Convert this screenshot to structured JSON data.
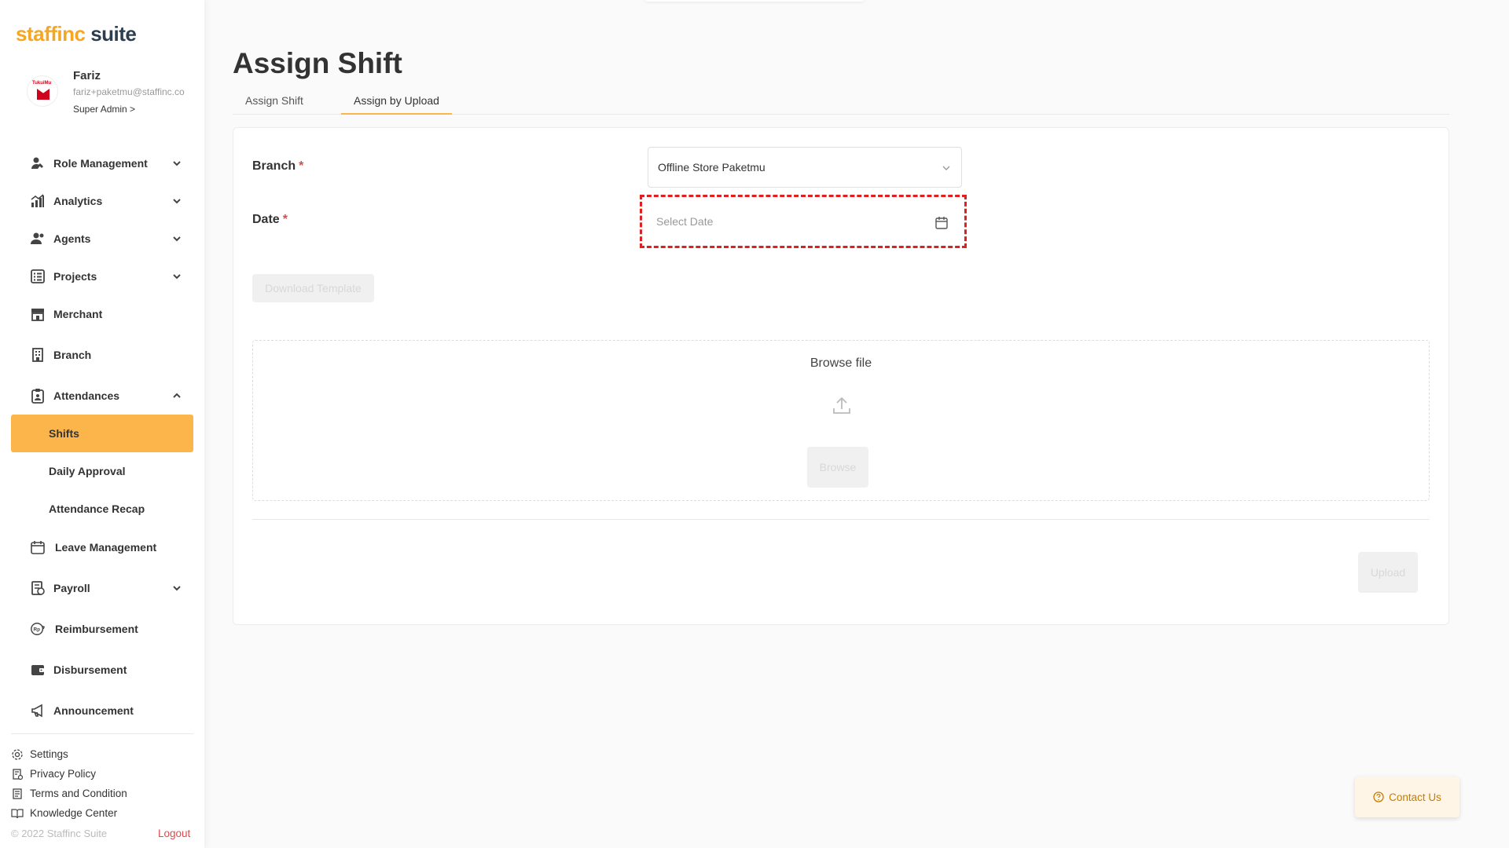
{
  "brand": {
    "name_part1": "staffinc",
    "name_part2": " suite",
    "accent": "#fbb54a"
  },
  "profile": {
    "name": "Fariz",
    "email": "fariz+paketmu@staffinc.co",
    "role": "Super Admin >",
    "avatar_text": "TukuiMu"
  },
  "sidebar": {
    "items": [
      {
        "label": "Role Management",
        "icon": "role-icon",
        "expandable": true
      },
      {
        "label": "Analytics",
        "icon": "analytics-icon",
        "expandable": true
      },
      {
        "label": "Agents",
        "icon": "agents-icon",
        "expandable": true
      },
      {
        "label": "Projects",
        "icon": "projects-icon",
        "expandable": true
      },
      {
        "label": "Merchant",
        "icon": "merchant-icon",
        "expandable": false
      },
      {
        "label": "Branch",
        "icon": "branch-icon",
        "expandable": false
      },
      {
        "label": "Attendances",
        "icon": "attendances-icon",
        "expandable": true,
        "expanded": true,
        "children": [
          {
            "label": "Shifts",
            "active": true
          },
          {
            "label": "Daily Approval"
          },
          {
            "label": "Attendance Recap"
          }
        ]
      },
      {
        "label": "Leave Management",
        "icon": "calendar-icon",
        "expandable": false
      },
      {
        "label": "Payroll",
        "icon": "payroll-icon",
        "expandable": true
      },
      {
        "label": "Reimbursement",
        "icon": "reimbursement-icon",
        "expandable": false
      },
      {
        "label": "Disbursement",
        "icon": "wallet-icon",
        "expandable": false
      },
      {
        "label": "Announcement",
        "icon": "megaphone-icon",
        "expandable": false
      }
    ],
    "footer": [
      {
        "label": "Settings",
        "icon": "gear-icon"
      },
      {
        "label": "Privacy Policy",
        "icon": "privacy-icon"
      },
      {
        "label": "Terms and Condition",
        "icon": "document-icon"
      },
      {
        "label": "Knowledge Center",
        "icon": "book-icon"
      }
    ],
    "copyright": "© 2022 Staffinc Suite",
    "logout": "Logout"
  },
  "page": {
    "title": "Assign Shift",
    "tabs": [
      {
        "label": "Assign Shift",
        "active": false
      },
      {
        "label": "Assign by Upload",
        "active": true
      }
    ]
  },
  "form": {
    "branch_label": "Branch",
    "branch_value": "Offline Store Paketmu",
    "date_label": "Date",
    "date_placeholder": "Select Date",
    "required_mark": "*",
    "download_template": "Download Template",
    "browse_title": "Browse file",
    "browse_button": "Browse",
    "upload_button": "Upload"
  },
  "contact": {
    "label": "Contact Us"
  }
}
